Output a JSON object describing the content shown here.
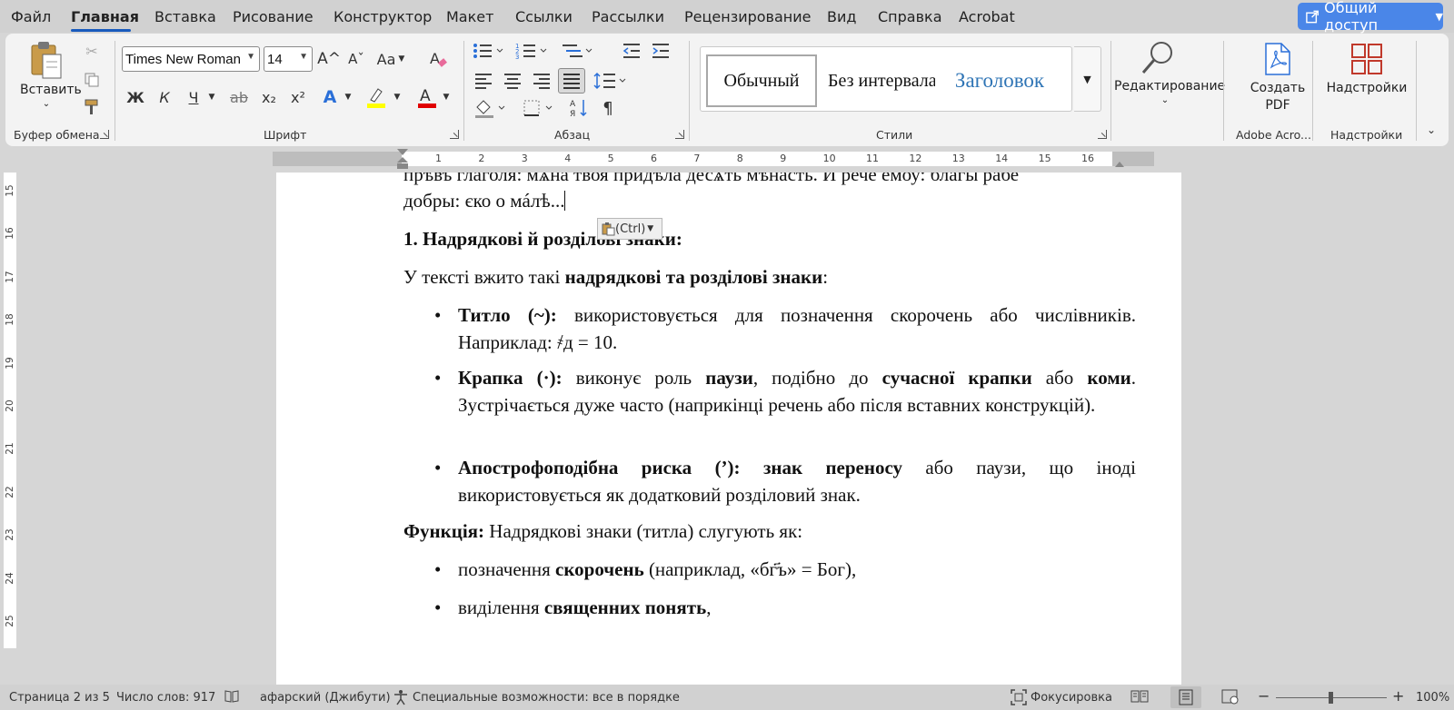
{
  "menu": {
    "items": [
      "Файл",
      "Главная",
      "Вставка",
      "Рисование",
      "Конструктор",
      "Макет",
      "Ссылки",
      "Рассылки",
      "Рецензирование",
      "Вид",
      "Справка",
      "Acrobat"
    ],
    "active": "Главная",
    "share_label": "Общий доступ"
  },
  "ribbon": {
    "clipboard": {
      "paste_label": "Вставить",
      "group_label": "Буфер обмена"
    },
    "font": {
      "font_name": "Times New Roman",
      "font_size": "14",
      "group_label": "Шрифт",
      "bold": "Ж",
      "italic": "К",
      "underline": "Ч",
      "strike": "ab",
      "sub": "x₂",
      "sup": "x²",
      "grow": "A^",
      "shrink": "Aˇ",
      "case": "Aa",
      "effects": "A",
      "highlight_color": "#ffff00",
      "font_color": "#e00000"
    },
    "paragraph": {
      "group_label": "Абзац"
    },
    "styles": {
      "items": [
        "Обычный",
        "Без интервала",
        "Заголовок"
      ],
      "group_label": "Стили",
      "heading_color": "#2e74b5"
    },
    "editing": {
      "label": "Редактирование"
    },
    "adobe": {
      "label_line1": "Создать",
      "label_line2": "PDF",
      "group_label": "Adobe Acro..."
    },
    "addins": {
      "label": "Надстройки",
      "group_label": "Надстройки"
    }
  },
  "ruler": {
    "numbers": [
      "1",
      "2",
      "3",
      "4",
      "5",
      "6",
      "7",
      "8",
      "9",
      "10",
      "11",
      "12",
      "13",
      "14",
      "15",
      "16"
    ]
  },
  "vruler": {
    "numbers": [
      "15",
      "16",
      "17",
      "18",
      "19",
      "20",
      "21",
      "22",
      "23",
      "24",
      "25"
    ]
  },
  "document": {
    "line_top": "прѣвъ глаголя: мѧна твоя придѣла десѧть мѣнасть. И рече емоу: благы рабе",
    "line_second": "добры: єко о мáлѣ...",
    "paste_badge": "(Ctrl)",
    "heading": "1. Надрядкові й розділові знаки:",
    "intro_pre": "У тексті вжито такі ",
    "intro_bold": "надрядкові та розділові знаки",
    "intro_post": ":",
    "bullets": [
      {
        "bold": "Титло (~):",
        "rest": " використовується для позначення скорочень або числівників. Наприклад: ҂д = 10."
      },
      {
        "bold1": "Крапка (·):",
        "t1": " виконує роль ",
        "bold2": "паузи",
        "t2": ", подібно до ",
        "bold3": "сучасної крапки",
        "t3": " або ",
        "bold4": "коми",
        "t4": ". Зустрічається дуже часто (наприкінці речень або після вставних конструкцій)."
      },
      {
        "bold1": "Апострофоподібна риска (’):",
        "t1": " ",
        "bold2": "знак переносу",
        "t2": " або паузи, що іноді використовується як додатковий розділовий знак."
      }
    ],
    "function_bold": "Функція:",
    "function_rest": " Надрядкові знаки (титла) слугують як:",
    "fn_bullets": [
      {
        "pre": "позначення ",
        "bold": "скорочень",
        "post": " (наприклад, «бг҃ъ» = Бог),"
      },
      {
        "pre": "виділення ",
        "bold": "священних понять",
        "post": ","
      }
    ]
  },
  "status": {
    "page": "Страница 2 из 5",
    "words": "Число слов: 917",
    "language": "афарский (Джибути)",
    "accessibility": "Специальные возможности: все в порядке",
    "focus": "Фокусировка",
    "zoom": "100%",
    "zoom_value": 100
  }
}
